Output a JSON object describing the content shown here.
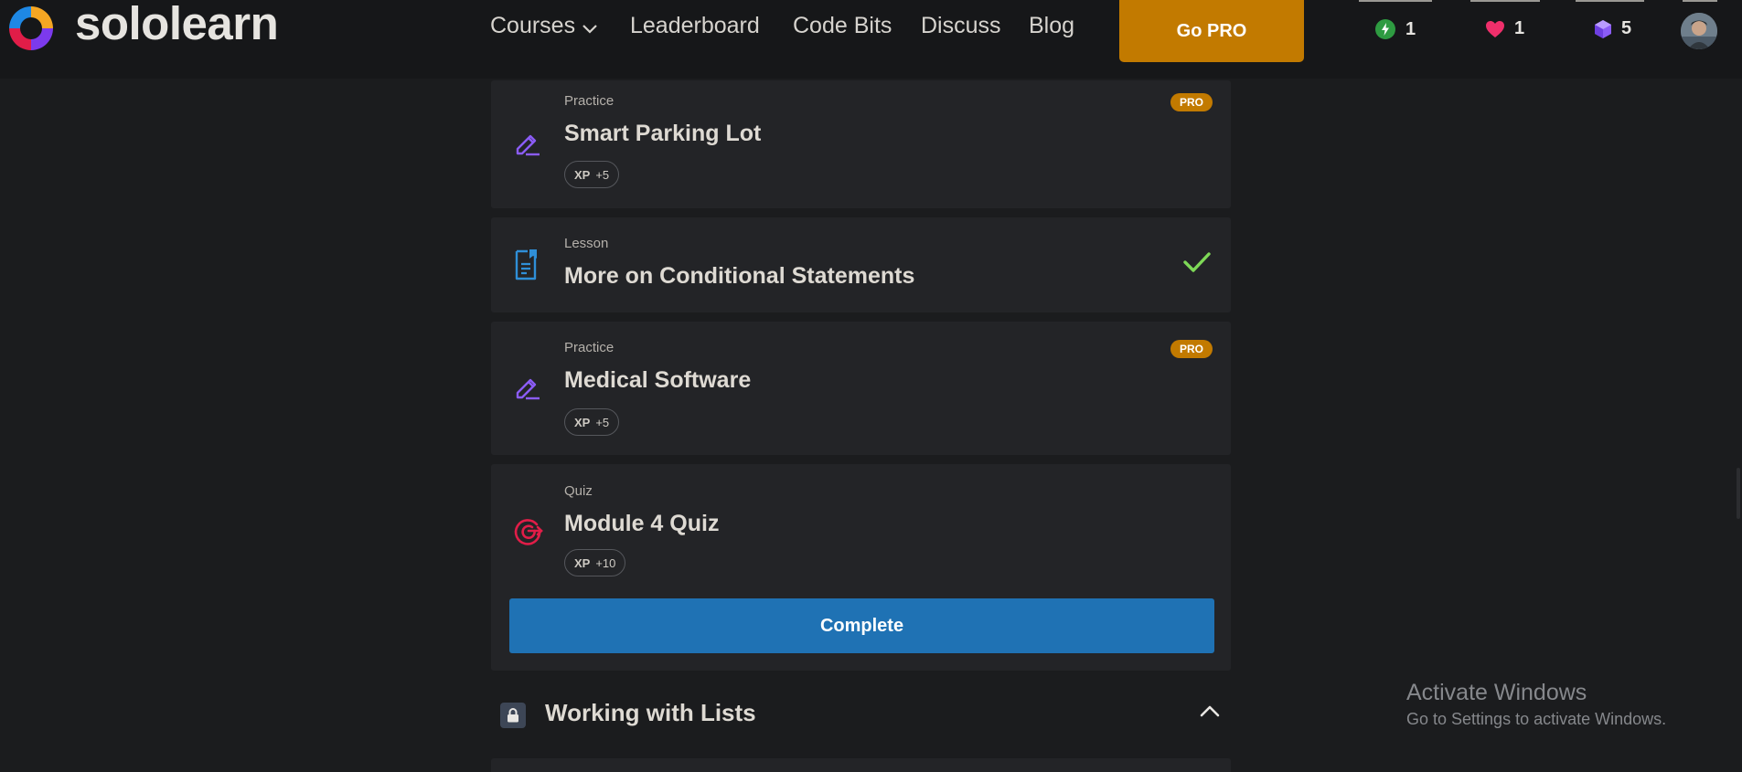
{
  "brand": {
    "name": "sololearn"
  },
  "nav": {
    "courses": "Courses",
    "leaderboard": "Leaderboard",
    "code_bits": "Code Bits",
    "discuss": "Discuss",
    "blog": "Blog",
    "go_pro": "Go PRO"
  },
  "stats": {
    "streak": "1",
    "hearts": "1",
    "bits": "5"
  },
  "cards": [
    {
      "type": "Practice",
      "title": "Smart Parking Lot",
      "xp_label": "XP",
      "xp_value": "+5",
      "badge": "PRO",
      "icon": "pencil-icon"
    },
    {
      "type": "Lesson",
      "title": "More on Conditional Statements",
      "completed": true,
      "icon": "lesson-document-icon"
    },
    {
      "type": "Practice",
      "title": "Medical Software",
      "xp_label": "XP",
      "xp_value": "+5",
      "badge": "PRO",
      "icon": "pencil-icon"
    },
    {
      "type": "Quiz",
      "title": "Module 4 Quiz",
      "xp_label": "XP",
      "xp_value": "+10",
      "icon": "target-icon",
      "button": "Complete"
    }
  ],
  "section": {
    "title": "Working with Lists",
    "locked": true
  },
  "watermark": {
    "title": "Activate Windows",
    "subtitle": "Go to Settings to activate Windows."
  },
  "colors": {
    "background": "#1b1c1e",
    "card": "#232427",
    "pro_accent": "#c27a00",
    "primary_button": "#1f72b4",
    "practice_icon": "#8b5cf6",
    "lesson_icon": "#2f8fd8",
    "quiz_icon": "#e11d48",
    "check": "#7ed957"
  }
}
